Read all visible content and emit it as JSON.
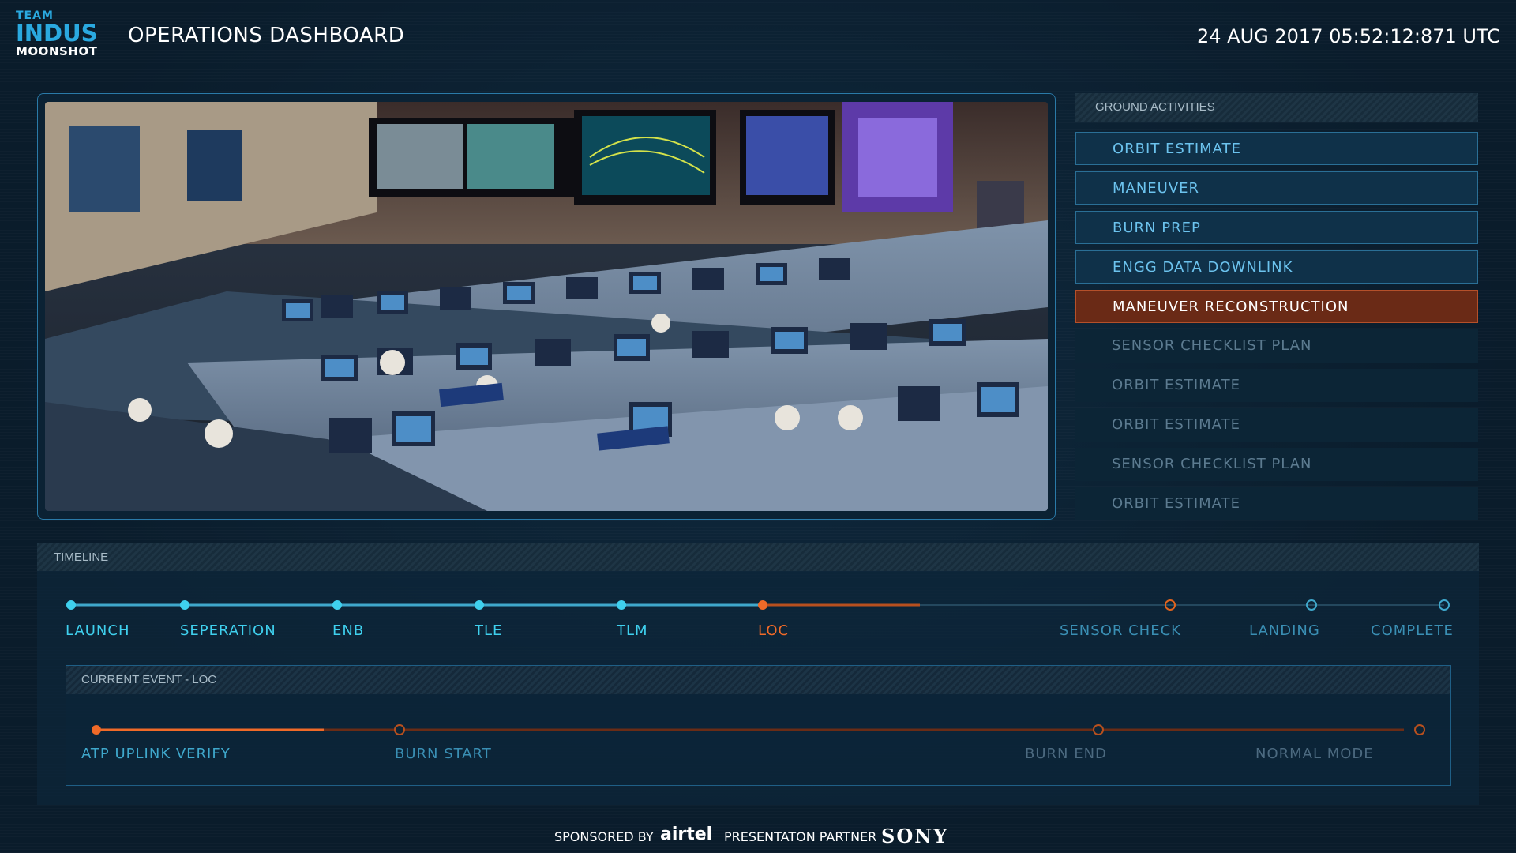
{
  "header": {
    "logo": {
      "line1": "TEAM",
      "line2": "INDUS",
      "line3": "MOONSHOT"
    },
    "title": "OPERATIONS DASHBOARD",
    "clock": "24 AUG 2017 05:52:12:871 UTC"
  },
  "video": {
    "description_icon": "mission-control-room-feed"
  },
  "ground_activities": {
    "title": "GROUND ACTIVITIES",
    "items": [
      {
        "label": "ORBIT ESTIMATE",
        "state": "done"
      },
      {
        "label": "MANEUVER",
        "state": "done"
      },
      {
        "label": "BURN PREP",
        "state": "done"
      },
      {
        "label": "ENGG DATA DOWNLINK",
        "state": "done"
      },
      {
        "label": "MANEUVER RECONSTRUCTION",
        "state": "current"
      },
      {
        "label": "SENSOR CHECKLIST PLAN",
        "state": "future"
      },
      {
        "label": "ORBIT ESTIMATE",
        "state": "future"
      },
      {
        "label": "ORBIT ESTIMATE",
        "state": "future"
      },
      {
        "label": "SENSOR CHECKLIST PLAN",
        "state": "future"
      },
      {
        "label": "ORBIT ESTIMATE",
        "state": "future"
      }
    ]
  },
  "timeline": {
    "title": "TIMELINE",
    "milestones": [
      {
        "label": "LAUNCH",
        "state": "done"
      },
      {
        "label": "SEPERATION",
        "state": "done"
      },
      {
        "label": "ENB",
        "state": "done"
      },
      {
        "label": "TLE",
        "state": "done"
      },
      {
        "label": "TLM",
        "state": "done"
      },
      {
        "label": "LOC",
        "state": "current"
      },
      {
        "label": "SENSOR CHECK",
        "state": "future"
      },
      {
        "label": "LANDING",
        "state": "future"
      },
      {
        "label": "COMPLETE",
        "state": "future"
      }
    ]
  },
  "current_event": {
    "title": "CURRENT EVENT - LOC",
    "steps": [
      {
        "label": "ATP UPLINK VERIFY",
        "state": "current"
      },
      {
        "label": "BURN START",
        "state": "future"
      },
      {
        "label": "BURN END",
        "state": "future"
      },
      {
        "label": "NORMAL MODE",
        "state": "future"
      }
    ]
  },
  "footer": {
    "sponsored_by": "SPONSORED BY",
    "sponsor_name": "airtel",
    "partner_label": "PRESENTATON PARTNER",
    "partner_name": "SONY"
  },
  "colors": {
    "done": "#3fd0ee",
    "current": "#f06a28",
    "future_label": "#5c7b90",
    "accent_blue": "#2aa9e0"
  }
}
